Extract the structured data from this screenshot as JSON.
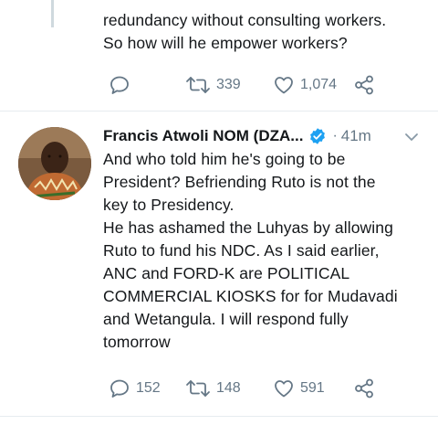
{
  "colors": {
    "text": "#14171a",
    "secondary": "#657786",
    "verified": "#1da1f2",
    "divider": "#e6ecf0",
    "thread_line": "#cfd9de"
  },
  "tweet1": {
    "text": "redundancy without consulting workers.\nSo how will he empower workers?",
    "actions": {
      "reply_icon": "reply-icon",
      "retweet_icon": "retweet-icon",
      "retweet_count": "339",
      "like_icon": "heart-icon",
      "like_count": "1,074",
      "share_icon": "share-icon"
    }
  },
  "tweet2": {
    "author_name": "Francis Atwoli NOM (DZA...",
    "verified_icon": "verified-badge-icon",
    "separator": "·",
    "time": "41m",
    "menu_icon": "chevron-down-icon",
    "avatar_icon": "avatar",
    "text": "And who told him he's going to be\nPresident? Befriending Ruto is not the\nkey to Presidency.\nHe has ashamed the Luhyas by allowing\nRuto to fund his NDC. As I said earlier,\nANC and FORD-K are POLITICAL\nCOMMERCIAL KIOSKS for for Mudavadi\nand Wetangula. I will respond fully\ntomorrow",
    "actions": {
      "reply_icon": "reply-icon",
      "reply_count": "152",
      "retweet_icon": "retweet-icon",
      "retweet_count": "148",
      "like_icon": "heart-icon",
      "like_count": "591",
      "share_icon": "share-icon"
    }
  }
}
